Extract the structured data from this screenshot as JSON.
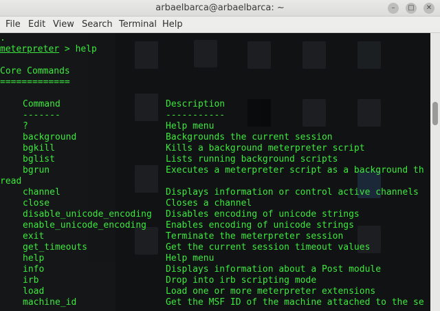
{
  "window": {
    "title": "arbaelbarca@arbaelbarca: ~",
    "minimize_glyph": "–",
    "maximize_glyph": "□",
    "close_glyph": "✕"
  },
  "menu": [
    "File",
    "Edit",
    "View",
    "Search",
    "Terminal",
    "Help"
  ],
  "terminal": {
    "top_dot": ".",
    "prompt": "meterpreter",
    "prompt_suffix": " > help",
    "section_title": "Core Commands",
    "section_rule": "=============",
    "header_command": "Command",
    "header_description": "Description",
    "rule_command": "-------",
    "rule_description": "-----------",
    "wrap_text": "read",
    "commands": [
      {
        "name": "?",
        "description": "Help menu"
      },
      {
        "name": "background",
        "description": "Backgrounds the current session"
      },
      {
        "name": "bgkill",
        "description": "Kills a background meterpreter script"
      },
      {
        "name": "bglist",
        "description": "Lists running background scripts"
      },
      {
        "name": "bgrun",
        "description": "Executes a meterpreter script as a background th"
      },
      {
        "name": "channel",
        "description": "Displays information or control active channels"
      },
      {
        "name": "close",
        "description": "Closes a channel"
      },
      {
        "name": "disable_unicode_encoding",
        "description": "Disables encoding of unicode strings"
      },
      {
        "name": "enable_unicode_encoding",
        "description": "Enables encoding of unicode strings"
      },
      {
        "name": "exit",
        "description": "Terminate the meterpreter session"
      },
      {
        "name": "get_timeouts",
        "description": "Get the current session timeout values"
      },
      {
        "name": "help",
        "description": "Help menu"
      },
      {
        "name": "info",
        "description": "Displays information about a Post module"
      },
      {
        "name": "irb",
        "description": "Drop into irb scripting mode"
      },
      {
        "name": "load",
        "description": "Load one or more meterpreter extensions"
      },
      {
        "name": "machine_id",
        "description": "Get the MSF ID of the machine attached to the se"
      }
    ]
  },
  "colors": {
    "terminal_text": "#3ee83e",
    "terminal_bg": "#101214",
    "titlebar_bg": "#e9e9e7"
  }
}
